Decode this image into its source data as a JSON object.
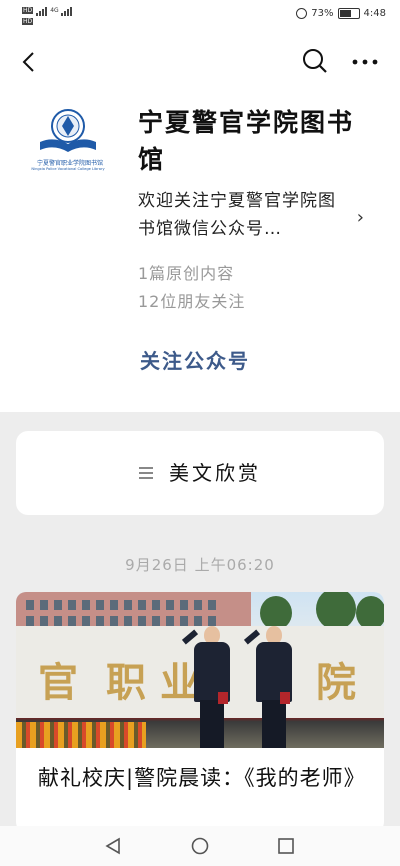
{
  "status_bar": {
    "sim1_label": "HD",
    "sim1_network": "4G",
    "sim2_label": "HD",
    "sim2_network": "4G",
    "battery_text": "73%",
    "battery_level": 0.73,
    "time": "4:48"
  },
  "nav": {
    "back_icon": "back-chevron-icon",
    "search_icon": "search-icon",
    "more_icon": "more-dots-icon"
  },
  "profile": {
    "logo_caption_cn": "宁夏警官职业学院图书馆",
    "logo_caption_en": "Ningxia Police Vocational College Library",
    "account_name": "宁夏警官学院图书馆",
    "description": "欢迎关注宁夏警官学院图书馆微信公众号…",
    "original_count": "1篇原创内容",
    "friends_following": "12位朋友关注",
    "follow_button": "关注公众号"
  },
  "content_tab": {
    "menu_icon": "hamburger-menu-icon",
    "label": "美文欣赏"
  },
  "feed": {
    "date": "9月26日 上午06:20",
    "article_title": "献礼校庆|警院晨读：《我的老师》",
    "image_wall_chars": [
      "官",
      "职",
      "业",
      "院"
    ]
  },
  "system_nav": {
    "back": "triangle-back-icon",
    "home": "circle-home-icon",
    "recents": "square-recents-icon"
  },
  "colors": {
    "follow_link": "#3d5a8a",
    "logo_blue": "#1f5aa8"
  }
}
